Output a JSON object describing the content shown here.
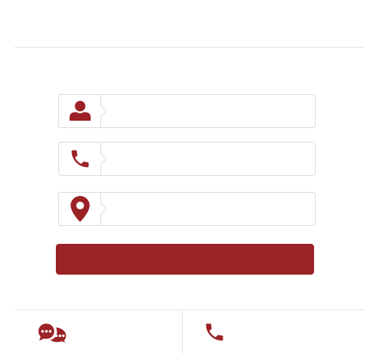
{
  "colors": {
    "accent": "#9b2226",
    "border": "#dedede",
    "divider": "#e6e6e6"
  },
  "form": {
    "fields": [
      {
        "icon": "user-icon",
        "value": "",
        "placeholder": ""
      },
      {
        "icon": "phone-icon",
        "value": "",
        "placeholder": ""
      },
      {
        "icon": "location-pin-icon",
        "value": "",
        "placeholder": ""
      }
    ],
    "submit": {
      "label": ""
    }
  },
  "footer": {
    "chat": {
      "icon": "chat-bubbles-icon",
      "label": ""
    },
    "call": {
      "icon": "phone-icon",
      "label": ""
    }
  }
}
